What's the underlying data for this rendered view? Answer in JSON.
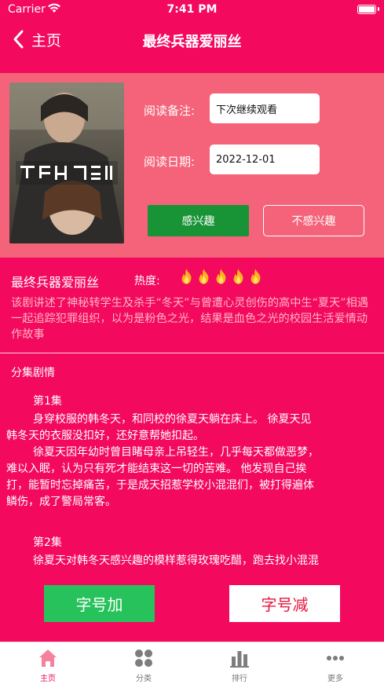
{
  "status_bar": {
    "carrier": "Carrier",
    "time": "7:41 PM"
  },
  "nav": {
    "back_label": "主页",
    "title": "最终兵器爱丽丝"
  },
  "info": {
    "note_label": "阅读备注:",
    "note_value": "下次继续观看",
    "date_label": "阅读日期:",
    "date_value": "2022-12-01",
    "interested_label": "感兴趣",
    "not_interested_label": "不感兴趣"
  },
  "show": {
    "title": "最终兵器爱丽丝",
    "heat_label": "热度:",
    "heat_value": 5,
    "description": "该剧讲述了神秘转学生及杀手“冬天”与曾遭心灵创伤的高中生“夏天”相遇一起追踪犯罪组织，以为是粉色之光，结果是血色之光的校园生活爱情动作故事"
  },
  "episodes": {
    "section_title": "分集剧情",
    "ep1_title": "第1集",
    "ep1_line1": "身穿校服的韩冬天，和同校的徐夏天躺在床上。 徐夏天见",
    "ep1_line2": "韩冬天的衣服没扣好，还好意帮她扣起。",
    "ep1_line3": "徐夏天因年幼时曾目睹母亲上吊轻生，几乎每天都做恶梦，",
    "ep1_line4": "难以入眠，认为只有死才能结束这一切的苦难。 他发现自己挨",
    "ep1_line5": "打，能暂时忘掉痛苦，于是成天招惹学校小混混们，被打得遍体",
    "ep1_line6": "鳞伤，成了警局常客。",
    "ep2_title": "第2集",
    "ep2_line1": "徐夏天对韩冬天感兴趣的模样惹得玫瑰吃醋，跑去找小混混"
  },
  "font_buttons": {
    "increase": "字号加",
    "decrease": "字号减"
  },
  "tabs": [
    {
      "label": "主页",
      "icon": "home-icon",
      "active": true
    },
    {
      "label": "分类",
      "icon": "category-icon",
      "active": false
    },
    {
      "label": "排行",
      "icon": "ranking-icon",
      "active": false
    },
    {
      "label": "更多",
      "icon": "more-icon",
      "active": false
    }
  ],
  "colors": {
    "primary": "#f3095e",
    "panel": "#f4637a",
    "interest_green": "#189436",
    "increase_green": "#27c25c",
    "decrease_red": "#e8163e"
  }
}
